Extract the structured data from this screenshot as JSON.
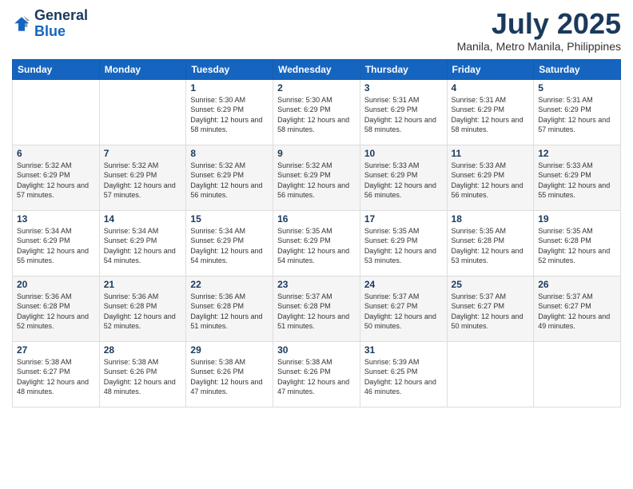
{
  "logo": {
    "general": "General",
    "blue": "Blue"
  },
  "title": "July 2025",
  "subtitle": "Manila, Metro Manila, Philippines",
  "days_of_week": [
    "Sunday",
    "Monday",
    "Tuesday",
    "Wednesday",
    "Thursday",
    "Friday",
    "Saturday"
  ],
  "weeks": [
    [
      {
        "day": "",
        "sunrise": "",
        "sunset": "",
        "daylight": ""
      },
      {
        "day": "",
        "sunrise": "",
        "sunset": "",
        "daylight": ""
      },
      {
        "day": "1",
        "sunrise": "Sunrise: 5:30 AM",
        "sunset": "Sunset: 6:29 PM",
        "daylight": "Daylight: 12 hours and 58 minutes."
      },
      {
        "day": "2",
        "sunrise": "Sunrise: 5:30 AM",
        "sunset": "Sunset: 6:29 PM",
        "daylight": "Daylight: 12 hours and 58 minutes."
      },
      {
        "day": "3",
        "sunrise": "Sunrise: 5:31 AM",
        "sunset": "Sunset: 6:29 PM",
        "daylight": "Daylight: 12 hours and 58 minutes."
      },
      {
        "day": "4",
        "sunrise": "Sunrise: 5:31 AM",
        "sunset": "Sunset: 6:29 PM",
        "daylight": "Daylight: 12 hours and 58 minutes."
      },
      {
        "day": "5",
        "sunrise": "Sunrise: 5:31 AM",
        "sunset": "Sunset: 6:29 PM",
        "daylight": "Daylight: 12 hours and 57 minutes."
      }
    ],
    [
      {
        "day": "6",
        "sunrise": "Sunrise: 5:32 AM",
        "sunset": "Sunset: 6:29 PM",
        "daylight": "Daylight: 12 hours and 57 minutes."
      },
      {
        "day": "7",
        "sunrise": "Sunrise: 5:32 AM",
        "sunset": "Sunset: 6:29 PM",
        "daylight": "Daylight: 12 hours and 57 minutes."
      },
      {
        "day": "8",
        "sunrise": "Sunrise: 5:32 AM",
        "sunset": "Sunset: 6:29 PM",
        "daylight": "Daylight: 12 hours and 56 minutes."
      },
      {
        "day": "9",
        "sunrise": "Sunrise: 5:32 AM",
        "sunset": "Sunset: 6:29 PM",
        "daylight": "Daylight: 12 hours and 56 minutes."
      },
      {
        "day": "10",
        "sunrise": "Sunrise: 5:33 AM",
        "sunset": "Sunset: 6:29 PM",
        "daylight": "Daylight: 12 hours and 56 minutes."
      },
      {
        "day": "11",
        "sunrise": "Sunrise: 5:33 AM",
        "sunset": "Sunset: 6:29 PM",
        "daylight": "Daylight: 12 hours and 56 minutes."
      },
      {
        "day": "12",
        "sunrise": "Sunrise: 5:33 AM",
        "sunset": "Sunset: 6:29 PM",
        "daylight": "Daylight: 12 hours and 55 minutes."
      }
    ],
    [
      {
        "day": "13",
        "sunrise": "Sunrise: 5:34 AM",
        "sunset": "Sunset: 6:29 PM",
        "daylight": "Daylight: 12 hours and 55 minutes."
      },
      {
        "day": "14",
        "sunrise": "Sunrise: 5:34 AM",
        "sunset": "Sunset: 6:29 PM",
        "daylight": "Daylight: 12 hours and 54 minutes."
      },
      {
        "day": "15",
        "sunrise": "Sunrise: 5:34 AM",
        "sunset": "Sunset: 6:29 PM",
        "daylight": "Daylight: 12 hours and 54 minutes."
      },
      {
        "day": "16",
        "sunrise": "Sunrise: 5:35 AM",
        "sunset": "Sunset: 6:29 PM",
        "daylight": "Daylight: 12 hours and 54 minutes."
      },
      {
        "day": "17",
        "sunrise": "Sunrise: 5:35 AM",
        "sunset": "Sunset: 6:29 PM",
        "daylight": "Daylight: 12 hours and 53 minutes."
      },
      {
        "day": "18",
        "sunrise": "Sunrise: 5:35 AM",
        "sunset": "Sunset: 6:28 PM",
        "daylight": "Daylight: 12 hours and 53 minutes."
      },
      {
        "day": "19",
        "sunrise": "Sunrise: 5:35 AM",
        "sunset": "Sunset: 6:28 PM",
        "daylight": "Daylight: 12 hours and 52 minutes."
      }
    ],
    [
      {
        "day": "20",
        "sunrise": "Sunrise: 5:36 AM",
        "sunset": "Sunset: 6:28 PM",
        "daylight": "Daylight: 12 hours and 52 minutes."
      },
      {
        "day": "21",
        "sunrise": "Sunrise: 5:36 AM",
        "sunset": "Sunset: 6:28 PM",
        "daylight": "Daylight: 12 hours and 52 minutes."
      },
      {
        "day": "22",
        "sunrise": "Sunrise: 5:36 AM",
        "sunset": "Sunset: 6:28 PM",
        "daylight": "Daylight: 12 hours and 51 minutes."
      },
      {
        "day": "23",
        "sunrise": "Sunrise: 5:37 AM",
        "sunset": "Sunset: 6:28 PM",
        "daylight": "Daylight: 12 hours and 51 minutes."
      },
      {
        "day": "24",
        "sunrise": "Sunrise: 5:37 AM",
        "sunset": "Sunset: 6:27 PM",
        "daylight": "Daylight: 12 hours and 50 minutes."
      },
      {
        "day": "25",
        "sunrise": "Sunrise: 5:37 AM",
        "sunset": "Sunset: 6:27 PM",
        "daylight": "Daylight: 12 hours and 50 minutes."
      },
      {
        "day": "26",
        "sunrise": "Sunrise: 5:37 AM",
        "sunset": "Sunset: 6:27 PM",
        "daylight": "Daylight: 12 hours and 49 minutes."
      }
    ],
    [
      {
        "day": "27",
        "sunrise": "Sunrise: 5:38 AM",
        "sunset": "Sunset: 6:27 PM",
        "daylight": "Daylight: 12 hours and 48 minutes."
      },
      {
        "day": "28",
        "sunrise": "Sunrise: 5:38 AM",
        "sunset": "Sunset: 6:26 PM",
        "daylight": "Daylight: 12 hours and 48 minutes."
      },
      {
        "day": "29",
        "sunrise": "Sunrise: 5:38 AM",
        "sunset": "Sunset: 6:26 PM",
        "daylight": "Daylight: 12 hours and 47 minutes."
      },
      {
        "day": "30",
        "sunrise": "Sunrise: 5:38 AM",
        "sunset": "Sunset: 6:26 PM",
        "daylight": "Daylight: 12 hours and 47 minutes."
      },
      {
        "day": "31",
        "sunrise": "Sunrise: 5:39 AM",
        "sunset": "Sunset: 6:25 PM",
        "daylight": "Daylight: 12 hours and 46 minutes."
      },
      {
        "day": "",
        "sunrise": "",
        "sunset": "",
        "daylight": ""
      },
      {
        "day": "",
        "sunrise": "",
        "sunset": "",
        "daylight": ""
      }
    ]
  ]
}
